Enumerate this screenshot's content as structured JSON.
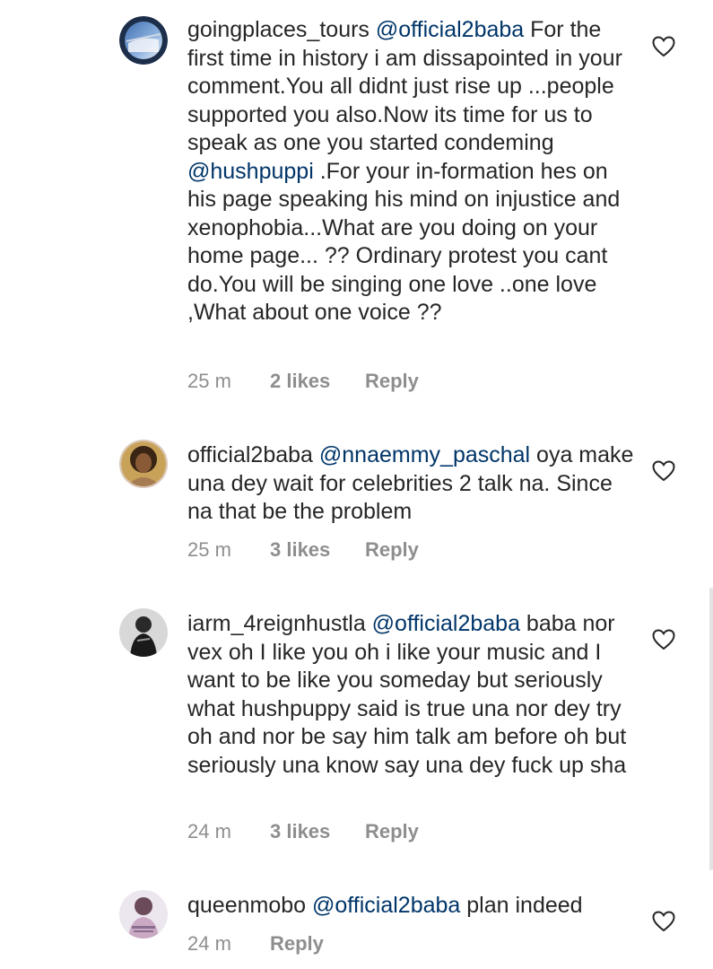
{
  "comments": [
    {
      "username": "goingplaces_tours",
      "mention": "@official2baba",
      "text_parts": [
        " For the first time in history i am dissapointed in your comment.You all didnt just rise up ...people supported you also.Now its time for us to speak as one you started condeming ",
        "@hushpuppi",
        " .For your in-formation hes on his page speaking his mind on injustice and xenophobia...What are you doing on your home page... ?? Ordinary protest you cant do.You will be singing one love ..one love ,What about one voice ??"
      ],
      "time": "25 m",
      "likes": "2 likes",
      "reply": "Reply",
      "avatar_icon": "airplane-window-avatar"
    },
    {
      "username": "official2baba",
      "mention": "@nnaemmy_paschal",
      "text": " oya make una dey wait for celebrities 2 talk na. Since na that be the problem",
      "time": "25 m",
      "likes": "3 likes",
      "reply": "Reply",
      "avatar_icon": "profile-photo-avatar"
    },
    {
      "username": "iarm_4reignhustla",
      "mention": "@official2baba",
      "text": " baba nor vex oh I like you oh i like your music and I want to be like you someday but seriously what hushpuppy said is true una nor dey try oh and nor be say him talk am before oh but seriously una know say una dey fuck up sha",
      "time": "24 m",
      "likes": "3 likes",
      "reply": "Reply",
      "avatar_icon": "profile-photo-avatar"
    },
    {
      "username": "queenmobo",
      "mention": "@official2baba",
      "text": " plan indeed",
      "time": "24 m",
      "reply": "Reply",
      "avatar_icon": "profile-photo-avatar"
    }
  ],
  "icons": {
    "like": "heart-outline-icon"
  },
  "colors": {
    "text": "#262626",
    "mention": "#003569",
    "meta": "#8e8e8e"
  }
}
